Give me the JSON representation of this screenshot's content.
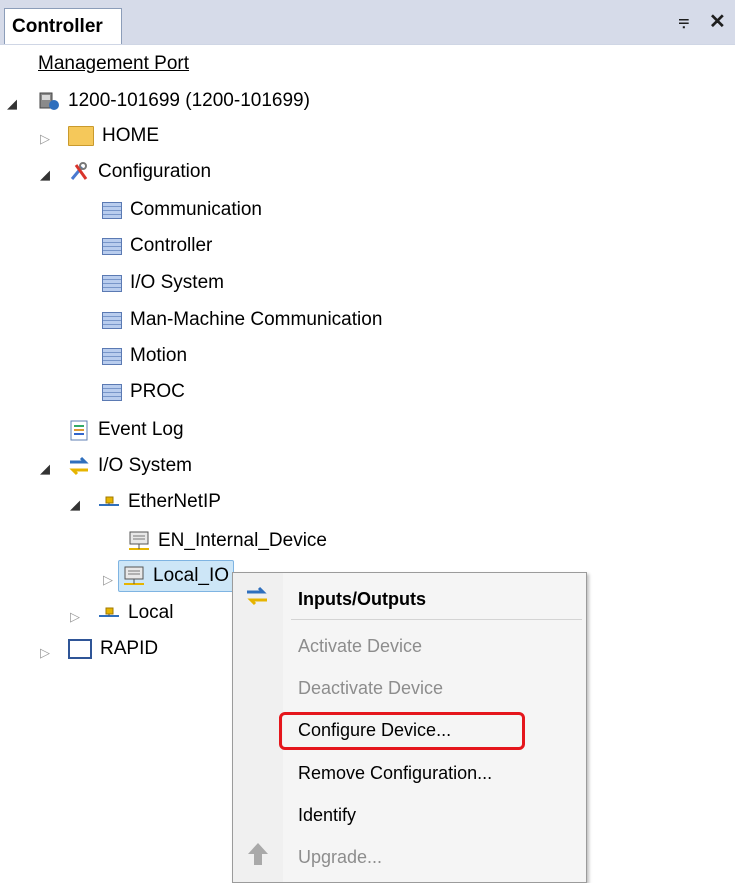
{
  "panel": {
    "tab_title": "Controller",
    "pin_glyph": "⩦",
    "close_glyph": "✕"
  },
  "tree": {
    "management_port": "Management Port",
    "controller": "1200-101699 (1200-101699)",
    "home": "HOME",
    "configuration": "Configuration",
    "config_items": [
      "Communication",
      "Controller",
      "I/O System",
      "Man-Machine Communication",
      "Motion",
      "PROC"
    ],
    "event_log": "Event Log",
    "io_system": "I/O System",
    "ethernetip": "EtherNetIP",
    "en_internal": "EN_Internal_Device",
    "local_io": "Local_IO",
    "local": "Local",
    "rapid": "RAPID"
  },
  "context_menu": {
    "items": [
      "Inputs/Outputs",
      "Activate Device",
      "Deactivate Device",
      "Configure Device...",
      "Remove Configuration...",
      "Identify",
      "Upgrade..."
    ],
    "highlighted": "Configure Device..."
  },
  "colors": {
    "highlight_border": "#e5161c",
    "selection_bg": "#cde6f7",
    "tab_bar": "#d6dbe9"
  }
}
